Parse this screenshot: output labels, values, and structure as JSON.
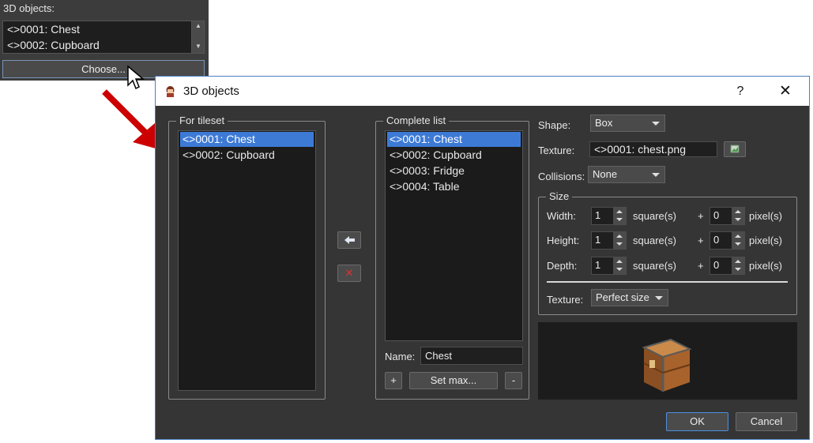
{
  "background_panel": {
    "title": "3D objects:",
    "items": [
      "<>0001: Chest",
      "<>0002: Cupboard"
    ],
    "choose_label": "Choose..."
  },
  "dialog": {
    "title": "3D objects",
    "help": "?",
    "close": "✕",
    "for_tileset": {
      "title": "For tileset",
      "items": [
        "<>0001: Chest",
        "<>0002: Cupboard"
      ],
      "selected_index": 0
    },
    "complete_list": {
      "title": "Complete list",
      "items": [
        "<>0001: Chest",
        "<>0002: Cupboard",
        "<>0003: Fridge",
        "<>0004: Table"
      ],
      "selected_index": 0,
      "name_label": "Name:",
      "name_value": "Chest",
      "add_label": "+",
      "set_max_label": "Set max...",
      "remove_label": "-"
    },
    "transfer": {
      "move_left_icon": "arrow-left-icon",
      "delete_icon": "red-x-icon"
    },
    "properties": {
      "shape_label": "Shape:",
      "shape_value": "Box",
      "texture_label": "Texture:",
      "texture_value": "<>0001: chest.png",
      "collisions_label": "Collisions:",
      "collisions_value": "None",
      "size": {
        "title": "Size",
        "rows": [
          {
            "label": "Width:",
            "squares": "1",
            "squares_unit": "square(s)",
            "plus": "+",
            "pixels": "0",
            "pixels_unit": "pixel(s)"
          },
          {
            "label": "Height:",
            "squares": "1",
            "squares_unit": "square(s)",
            "plus": "+",
            "pixels": "0",
            "pixels_unit": "pixel(s)"
          },
          {
            "label": "Depth:",
            "squares": "1",
            "squares_unit": "square(s)",
            "plus": "+",
            "pixels": "0",
            "pixels_unit": "pixel(s)"
          }
        ],
        "texture_label": "Texture:",
        "texture_value": "Perfect size"
      }
    },
    "ok_label": "OK",
    "cancel_label": "Cancel"
  },
  "colors": {
    "selection": "#3d7ad6",
    "dialog_bg": "#353535",
    "accent_border": "#4b7fbf",
    "arrow": "#cc0000"
  }
}
